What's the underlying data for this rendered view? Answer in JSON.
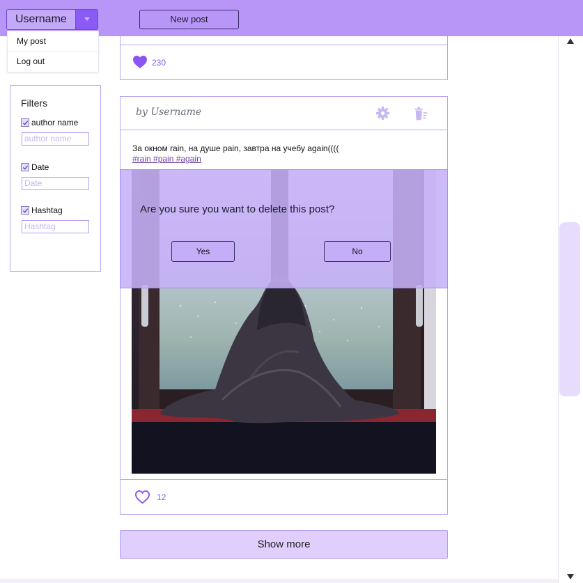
{
  "header": {
    "username": "Username",
    "new_post_label": "New post"
  },
  "user_menu": {
    "items": [
      {
        "label": "My post"
      },
      {
        "label": "Log out"
      }
    ]
  },
  "filters": {
    "title": "Filters",
    "author": {
      "label": "author name",
      "checked": true,
      "placeholder": "author name"
    },
    "date": {
      "label": "Date",
      "checked": true,
      "placeholder": "Date"
    },
    "hashtag": {
      "label": "Hashtag",
      "checked": true,
      "placeholder": "Hashtag"
    }
  },
  "previous_post": {
    "likes": "230",
    "liked": true
  },
  "post": {
    "author": "by Username",
    "text": "За окном rain, на душе pain, завтра на учебу again((((",
    "tags": " #rain #pain #again ",
    "likes": "12",
    "liked": false,
    "icons": [
      "gear-icon",
      "trash-icon",
      "heart-icon"
    ]
  },
  "delete_dialog": {
    "question": "Are you sure you want to delete this post?",
    "yes_label": "Yes",
    "no_label": "No"
  },
  "show_more_label": "Show more",
  "colors": {
    "header_bg": "#b796f7",
    "accent": "#8a5cf5",
    "border": "#b9a4ef",
    "like": "#7c5cf0",
    "modal_bg": "#c6b0f8",
    "show_more_bg": "#e0cffc"
  }
}
